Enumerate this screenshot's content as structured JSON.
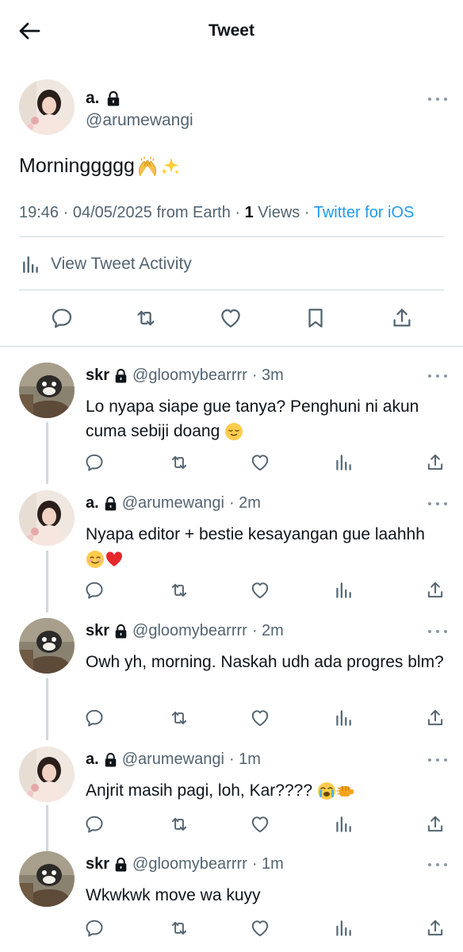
{
  "header": {
    "title": "Tweet"
  },
  "main_tweet": {
    "name": "a.",
    "handle": "@arumewangi",
    "text": "Morninggggg",
    "time_date": "19:46 · 04/05/2025 from Earth · ",
    "views_count": "1",
    "views_label": " Views · ",
    "source": "Twitter for iOS",
    "activity_label": "View Tweet Activity"
  },
  "replies": [
    {
      "name": "skr",
      "handle": "@gloomybearrrr",
      "time": "· 3m",
      "text": "Lo nyapa siape gue tanya? Penghuni ni akun cuma sebiji doang"
    },
    {
      "name": "a.",
      "handle": "@arumewangi",
      "time": "· 2m",
      "text": "Nyapa editor + bestie kesayangan gue laahhh"
    },
    {
      "name": "skr",
      "handle": "@gloomybearrrr",
      "time": "· 2m",
      "text": "Owh yh, morning. Naskah udh ada progres blm?"
    },
    {
      "name": "a.",
      "handle": "@arumewangi",
      "time": "· 1m",
      "text": "Anjrit masih pagi, loh, Kar????"
    },
    {
      "name": "skr",
      "handle": "@gloomybearrrr",
      "time": "· 1m",
      "text": "Wkwkwk move wa kuyy"
    }
  ],
  "icons": [
    "back-arrow-icon",
    "lock-icon",
    "more-icon",
    "raising-hands-emoji",
    "sparkles-emoji",
    "bar-chart-icon",
    "reply-icon",
    "retweet-icon",
    "like-icon",
    "bookmark-icon",
    "share-icon",
    "views-icon",
    "relieved-face-emoji",
    "smiling-face-emoji",
    "red-heart-emoji",
    "crying-face-emoji",
    "fist-bump-emoji"
  ],
  "colors": {
    "text": "#0f1419",
    "secondary": "#536471",
    "link": "#1d9bf0",
    "divider": "#cfd9de"
  }
}
